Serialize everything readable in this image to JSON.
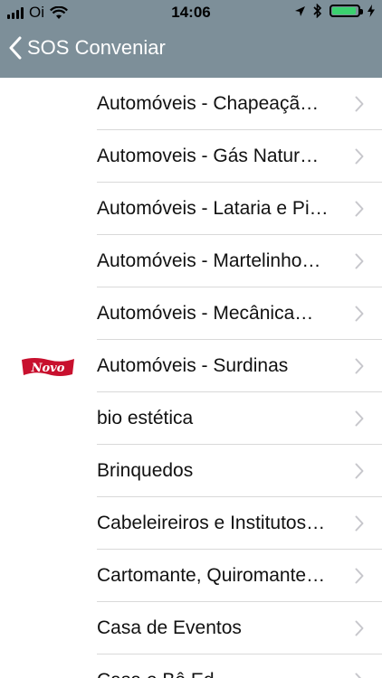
{
  "status": {
    "carrier": "Oi",
    "time": "14:06"
  },
  "nav": {
    "back_label": "SOS Conveniar"
  },
  "colors": {
    "bar": "#7d8f99",
    "battery": "#3bd16f",
    "badge": "#c8102e"
  },
  "badge_text": "Novo",
  "items": [
    {
      "label": "Automóveis - Chapeaçã…"
    },
    {
      "label": "Automoveis - Gás Natur…"
    },
    {
      "label": "Automóveis - Lataria e Pi…"
    },
    {
      "label": "Automóveis - Martelinho…"
    },
    {
      "label": "Automóveis - Mecânica…"
    },
    {
      "label": "Automóveis - Surdinas",
      "badge": true
    },
    {
      "label": "bio estética"
    },
    {
      "label": "Brinquedos"
    },
    {
      "label": "Cabeleireiros e Institutos…"
    },
    {
      "label": "Cartomante, Quiromante…"
    },
    {
      "label": "Casa de Eventos"
    },
    {
      "label": "Casa e Bê Ed…"
    }
  ]
}
